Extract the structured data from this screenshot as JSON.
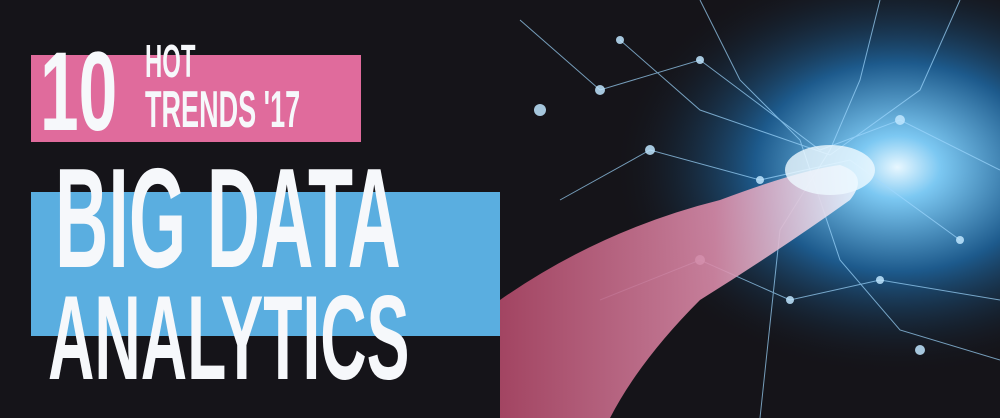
{
  "banner": {
    "number": "10",
    "line1": "HOT",
    "line2": "TRENDS '17",
    "title1": "BIG DATA",
    "title2": "ANALYTICS"
  },
  "colors": {
    "background": "#151419",
    "pink": "#e06b9c",
    "blue": "#5aaee0",
    "text": "#f6f8fb",
    "glow": "#bfe6ff"
  }
}
